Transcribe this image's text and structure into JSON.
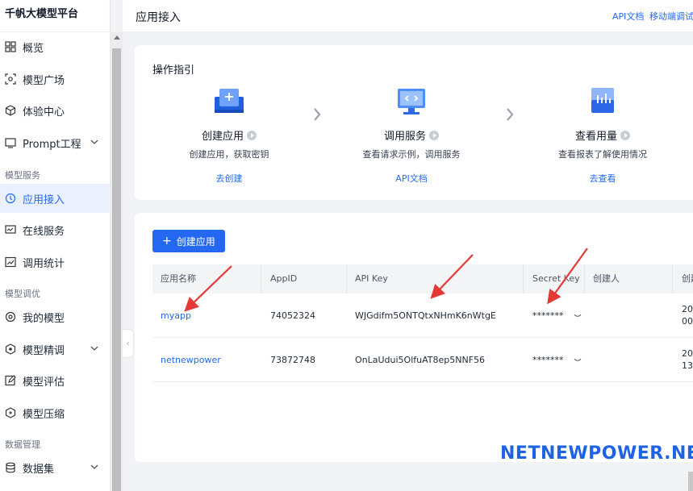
{
  "brand": "千帆大模型平台",
  "sidebar": {
    "items": [
      {
        "label": "概览",
        "icon": "grid-icon"
      },
      {
        "label": "模型广场",
        "icon": "scan-icon"
      },
      {
        "label": "体验中心",
        "icon": "cube-icon"
      },
      {
        "label": "Prompt工程",
        "icon": "prompt-icon",
        "expandable": true
      }
    ],
    "section_model_service": "模型服务",
    "service_items": [
      {
        "label": "应用接入",
        "icon": "clock-icon",
        "active": true
      },
      {
        "label": "在线服务",
        "icon": "monitor-icon"
      },
      {
        "label": "调用统计",
        "icon": "chart-icon"
      }
    ],
    "section_model_tuning": "模型调优",
    "tuning_items": [
      {
        "label": "我的模型",
        "icon": "gear-icon"
      },
      {
        "label": "模型精调",
        "icon": "hex-icon",
        "expandable": true
      },
      {
        "label": "模型评估",
        "icon": "edit-icon"
      },
      {
        "label": "模型压缩",
        "icon": "shield-icon"
      }
    ],
    "section_data": "数据管理",
    "data_items": [
      {
        "label": "数据集",
        "icon": "database-icon",
        "expandable": true
      }
    ]
  },
  "header": {
    "title": "应用接入",
    "links": [
      "API文档",
      "移动端调试"
    ]
  },
  "guide": {
    "title": "操作指引",
    "steps": [
      {
        "title": "创建应用",
        "desc": "创建应用，获取密钥",
        "link": "去创建"
      },
      {
        "title": "调用服务",
        "desc": "查看请求示例，调用服务",
        "link": "API文档"
      },
      {
        "title": "查看用量",
        "desc": "查看报表了解使用情况",
        "link": "去查看"
      }
    ]
  },
  "apps": {
    "create_button": "创建应用",
    "columns": [
      "应用名称",
      "AppID",
      "API Key",
      "Secret Key",
      "创建人",
      "创建"
    ],
    "rows": [
      {
        "name": "myapp",
        "appid": "74052324",
        "api_key": "WJGdifm5ONTQtxNHmK6nWtgE",
        "secret": "*******",
        "creator": "",
        "created_1": "20",
        "created_2": "00"
      },
      {
        "name": "netnewpower",
        "appid": "73872748",
        "api_key": "OnLaUdui5OlfuAT8ep5NNF56",
        "secret": "*******",
        "creator": "",
        "created_1": "20",
        "created_2": "13"
      }
    ]
  },
  "watermark": "NETNEWPOWER.NET",
  "colors": {
    "accent": "#2468f2",
    "annotation": "#e53935",
    "active_bg": "#eaf1fd"
  }
}
